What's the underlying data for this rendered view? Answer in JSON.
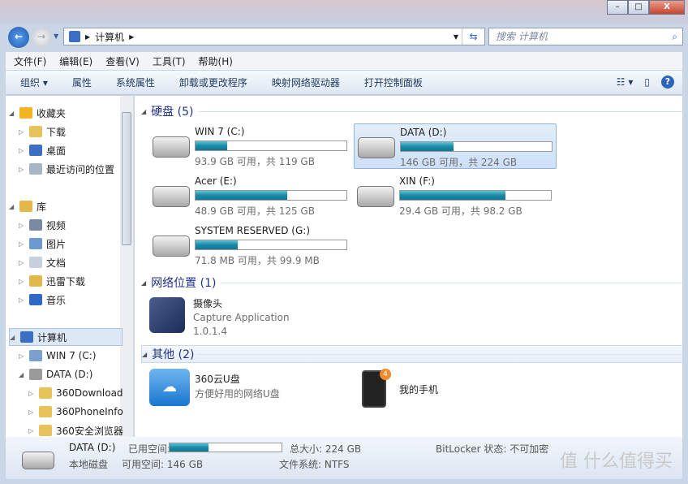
{
  "window": {
    "controls": {
      "minimize": "–",
      "maximize": "□",
      "close": "X"
    }
  },
  "address": {
    "path": [
      "计算机"
    ],
    "search_placeholder": "搜索 计算机"
  },
  "menu": [
    "文件(F)",
    "编辑(E)",
    "查看(V)",
    "工具(T)",
    "帮助(H)"
  ],
  "toolbar": [
    "组织 ▾",
    "属性",
    "系统属性",
    "卸载或更改程序",
    "映射网络驱动器",
    "打开控制面板"
  ],
  "nav": {
    "items": [
      {
        "label": "收藏夹",
        "icon": "star-icon",
        "level": 0,
        "expanded": true
      },
      {
        "label": "下载",
        "icon": "download-folder-icon",
        "level": 1
      },
      {
        "label": "桌面",
        "icon": "desktop-icon",
        "level": 1
      },
      {
        "label": "最近访问的位置",
        "icon": "recent-places-icon",
        "level": 1
      },
      {
        "label": "库",
        "icon": "library-icon",
        "level": 0,
        "expanded": true
      },
      {
        "label": "视频",
        "icon": "video-library-icon",
        "level": 1
      },
      {
        "label": "图片",
        "icon": "picture-library-icon",
        "level": 1
      },
      {
        "label": "文档",
        "icon": "document-library-icon",
        "level": 1
      },
      {
        "label": "迅雷下载",
        "icon": "library-icon",
        "level": 1
      },
      {
        "label": "音乐",
        "icon": "music-library-icon",
        "level": 1
      },
      {
        "label": "计算机",
        "icon": "computer-icon",
        "level": 0,
        "expanded": true,
        "selected": true
      },
      {
        "label": "WIN 7 (C:)",
        "icon": "system-drive-icon",
        "level": 1
      },
      {
        "label": "DATA (D:)",
        "icon": "drive-icon",
        "level": 1,
        "expanded": true
      },
      {
        "label": "360Download",
        "icon": "folder-icon",
        "level": 2
      },
      {
        "label": "360PhoneInfo",
        "icon": "folder-icon",
        "level": 2
      },
      {
        "label": "360安全浏览器",
        "icon": "folder-icon",
        "level": 2
      }
    ]
  },
  "groups": {
    "drives": "硬盘 (5)",
    "network": "网络位置 (1)",
    "other": "其他 (2)"
  },
  "drives": [
    {
      "name": "WIN 7 (C:)",
      "info": "93.9 GB 可用，共 119 GB",
      "used_pct": 21
    },
    {
      "name": "DATA (D:)",
      "info": "146 GB 可用，共 224 GB",
      "used_pct": 35,
      "selected": true
    },
    {
      "name": "Acer (E:)",
      "info": "48.9 GB 可用，共 125 GB",
      "used_pct": 61
    },
    {
      "name": "XIN (F:)",
      "info": "29.4 GB 可用，共 98.2 GB",
      "used_pct": 70
    },
    {
      "name": "SYSTEM RESERVED (G:)",
      "info": "71.8 MB 可用，共 99.9 MB",
      "used_pct": 28
    }
  ],
  "network_item": {
    "name": "摄像头",
    "desc": "Capture Application",
    "version": "1.0.1.4"
  },
  "other_items": [
    {
      "name": "360云U盘",
      "desc": "方便好用的网络U盘"
    },
    {
      "name": "我的手机",
      "badge": "4"
    }
  ],
  "status": {
    "name": "DATA (D:)",
    "type": "本地磁盘",
    "used_label": "已用空间:",
    "free": "可用空间: 146 GB",
    "total": "总大小: 224 GB",
    "fs": "文件系统: NTFS",
    "bitlocker": "BitLocker 状态: 不可加密",
    "used_pct": 35
  },
  "watermark": "值 什么值得买"
}
